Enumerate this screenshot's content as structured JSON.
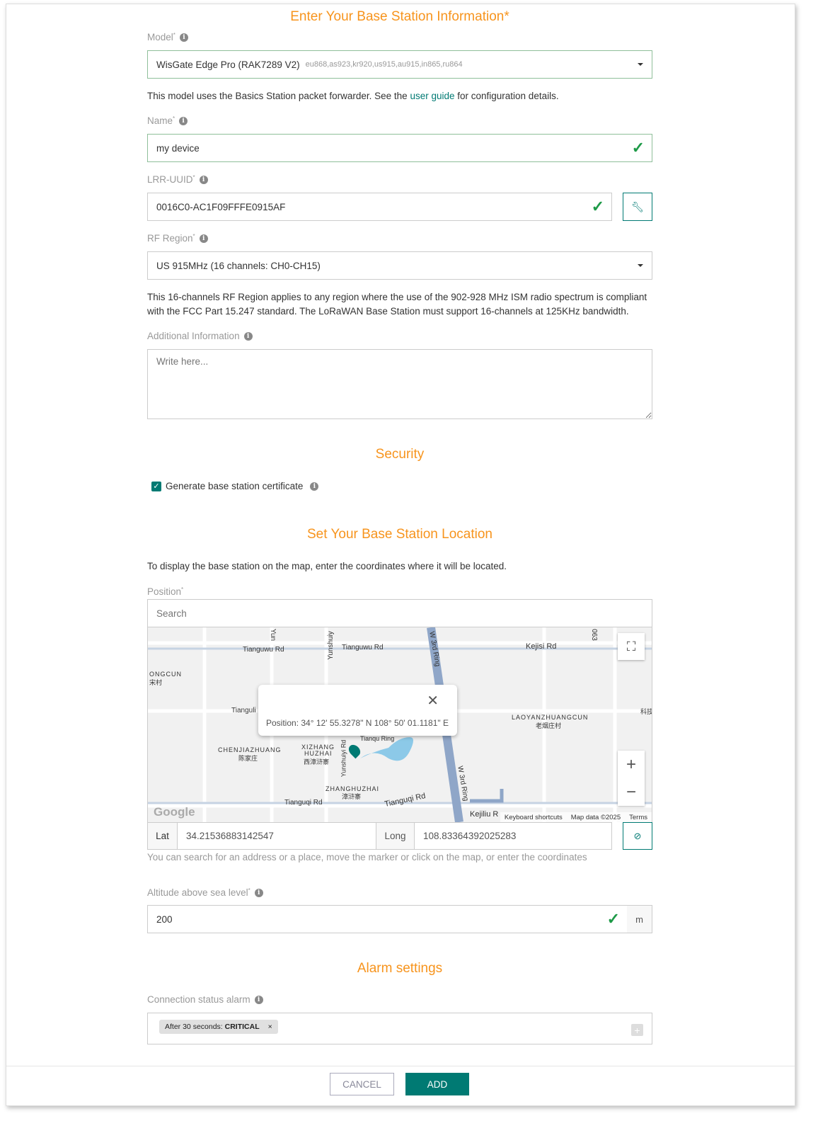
{
  "title": "Enter Your Base Station Information*",
  "model": {
    "label": "Model",
    "value": "WisGate Edge Pro (RAK7289 V2)",
    "bands": "eu868,as923,kr920,us915,au915,in865,ru864",
    "desc_pre": "This model uses the Basics Station packet forwarder. See the ",
    "desc_link": "user guide",
    "desc_post": " for configuration details."
  },
  "name": {
    "label": "Name",
    "value": "my device"
  },
  "lrr": {
    "label": "LRR-UUID",
    "value": "0016C0-AC1F09FFFE0915AF"
  },
  "rf": {
    "label": "RF Region",
    "value": "US 915MHz (16 channels: CH0-CH15)",
    "desc1": "This 16-channels RF Region applies to any region where the use of the 902-928 MHz ISM radio spectrum is compliant",
    "desc2": "with the FCC Part 15.247 standard. The LoRaWAN Base Station must support 16-channels at 125KHz bandwidth."
  },
  "additional": {
    "label": "Additional Information",
    "placeholder": "Write here..."
  },
  "security": {
    "title": "Security",
    "checkbox_label": "Generate base station certificate",
    "checked": true
  },
  "location": {
    "title": "Set Your Base Station Location",
    "desc": "To display the base station on the map, enter the coordinates where it will be located.",
    "position_label": "Position",
    "search_placeholder": "Search",
    "popup": "Position: 34° 12' 55.3278\" N 108° 50' 01.1181\" E",
    "lat_label": "Lat",
    "lat": "34.21536883142547",
    "long_label": "Long",
    "long": "108.83364392025283",
    "hint": "You can search for an address or a place, move the marker or click on the map, or enter the coordinates",
    "map_labels": [
      "Tianguwu Rd",
      "Tianguwu Rd",
      "Kejisi Rd",
      "Yunshuiy",
      "Yun",
      "W 3rd Ring",
      "063",
      "ONGCUN",
      "宋村",
      "Tianguli",
      "LAOYANZHUANGCUN",
      "老烟庄村",
      "科技",
      "CHENJIAZHUANG",
      "陈家庄",
      "XIZHANG",
      "HUZHAI",
      "西漳浒寨",
      "Yunshuiyi Rd",
      "Tianqu Ring",
      "W 3rd Ring",
      "ZHANGHUZHAI",
      "漳浒寨",
      "Tianguqi Rd",
      "Tianguqi Rd",
      "Kejiliu R"
    ],
    "map_footer": {
      "logo": "Google",
      "shortcuts": "Keyboard shortcuts",
      "mapdata": "Map data ©2025",
      "terms": "Terms"
    }
  },
  "altitude": {
    "label": "Altitude above sea level",
    "value": "200",
    "unit": "m"
  },
  "alarm": {
    "title": "Alarm settings",
    "label": "Connection status alarm",
    "tag_pre": "After 30 seconds: ",
    "tag_level": "CRITICAL"
  },
  "footer": {
    "cancel": "CANCEL",
    "add": "ADD"
  },
  "colors": {
    "accent": "#f7941d",
    "primary": "#007a73",
    "valid": "#1e9a48"
  }
}
